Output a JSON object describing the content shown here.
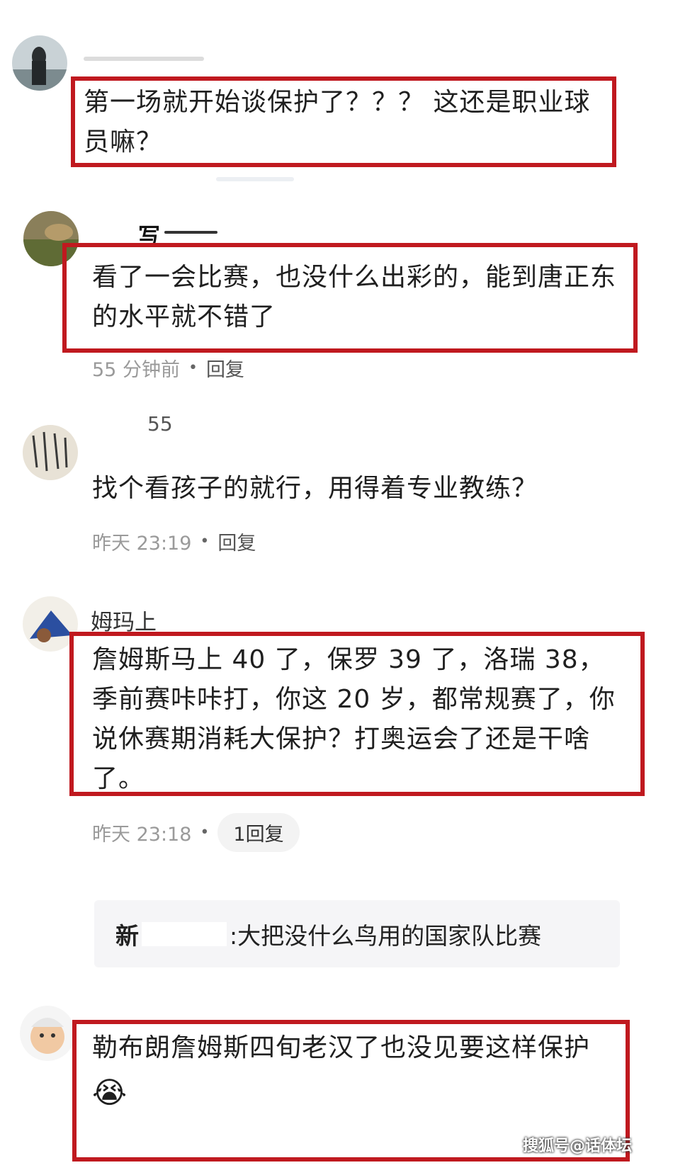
{
  "comments": [
    {
      "username": "",
      "text": "第一场就开始谈保护了？？？ 这还是职业球员嘛？"
    },
    {
      "username": "写",
      "text": "看了一会比赛，也没什么出彩的，能到唐正东的水平就不错了",
      "time": "55 分钟前",
      "reply": "回复"
    },
    {
      "username": "55",
      "text": "找个看孩子的就行，用得着专业教练？",
      "time": "昨天 23:19",
      "reply": "回复"
    },
    {
      "username": "姆玛上",
      "text": "詹姆斯马上 40 了，保罗 39 了，洛瑞 38，季前赛咔咔打，你这 20 岁，都常规赛了，你说休赛期消耗大保护？打奥运会了还是干啥了。",
      "time": "昨天 23:18",
      "reply": "1回复",
      "subreply": {
        "name": "新",
        "text": ":大把没什么鸟用的国家队比赛"
      }
    },
    {
      "username": "",
      "text": "勒布朗詹姆斯四旬老汉了也没见要这样保护",
      "emoji": "😭"
    }
  ],
  "watermark": "搜狐号@话体坛",
  "colors": {
    "highlight": "#c0191f",
    "meta": "#9a9a9a"
  },
  "icons": [
    "avatar-image",
    "crying-emoji"
  ]
}
